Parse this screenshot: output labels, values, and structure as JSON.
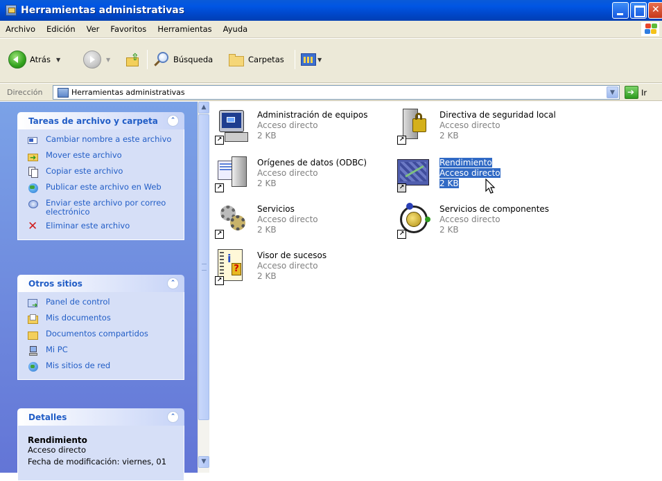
{
  "window": {
    "title": "Herramientas administrativas"
  },
  "menu": [
    "Archivo",
    "Edición",
    "Ver",
    "Favoritos",
    "Herramientas",
    "Ayuda"
  ],
  "toolbar": {
    "back_label": "Atrás",
    "search_label": "Búsqueda",
    "folders_label": "Carpetas"
  },
  "address": {
    "label": "Dirección",
    "value": "Herramientas administrativas",
    "go_label": "Ir"
  },
  "tasks_panel": {
    "title": "Tareas de archivo y carpeta",
    "items": [
      {
        "label": "Cambiar nombre a este archivo",
        "icon": "rename-icon"
      },
      {
        "label": "Mover este archivo",
        "icon": "move-icon"
      },
      {
        "label": "Copiar este archivo",
        "icon": "copy-icon"
      },
      {
        "label": "Publicar este archivo en Web",
        "icon": "publish-web-icon"
      },
      {
        "label": "Enviar este archivo por correo electrónico",
        "icon": "email-icon"
      },
      {
        "label": "Eliminar este archivo",
        "icon": "delete-icon"
      }
    ]
  },
  "places_panel": {
    "title": "Otros sitios",
    "items": [
      {
        "label": "Panel de control",
        "icon": "control-panel-icon"
      },
      {
        "label": "Mis documentos",
        "icon": "my-documents-icon"
      },
      {
        "label": "Documentos compartidos",
        "icon": "shared-documents-icon"
      },
      {
        "label": "Mi PC",
        "icon": "my-computer-icon"
      },
      {
        "label": "Mis sitios de red",
        "icon": "network-places-icon"
      }
    ]
  },
  "details_panel": {
    "title": "Detalles",
    "name": "Rendimiento",
    "type": "Acceso directo",
    "modified": "Fecha de modificación: viernes, 01"
  },
  "files": [
    {
      "name": "Administración de equipos",
      "type": "Acceso directo",
      "size": "2 KB",
      "icon": "computer-management-icon"
    },
    {
      "name": "Directiva de seguridad local",
      "type": "Acceso directo",
      "size": "2 KB",
      "icon": "local-security-policy-icon"
    },
    {
      "name": "Orígenes de datos (ODBC)",
      "type": "Acceso directo",
      "size": "2 KB",
      "icon": "odbc-icon"
    },
    {
      "name": "Rendimiento",
      "type": "Acceso directo",
      "size": "2 KB",
      "icon": "performance-icon",
      "selected": true
    },
    {
      "name": "Servicios",
      "type": "Acceso directo",
      "size": "2 KB",
      "icon": "services-icon"
    },
    {
      "name": "Servicios de componentes",
      "type": "Acceso directo",
      "size": "2 KB",
      "icon": "component-services-icon"
    },
    {
      "name": "Visor de sucesos",
      "type": "Acceso directo",
      "size": "2 KB",
      "icon": "event-viewer-icon"
    }
  ],
  "colors": {
    "titlebar": "#0054e3",
    "taskpane": "#7ba2e7",
    "link": "#215dc6",
    "selection": "#316ac5"
  }
}
